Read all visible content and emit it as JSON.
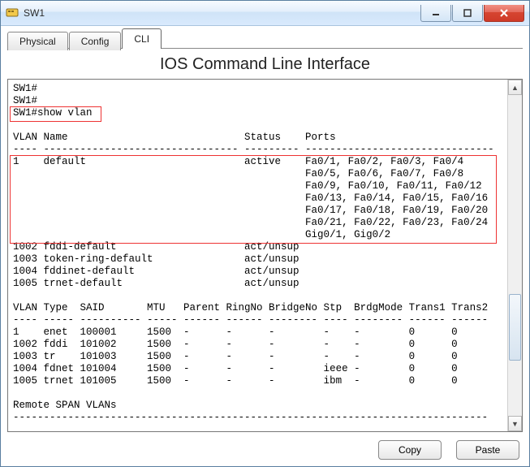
{
  "window": {
    "title": "SW1"
  },
  "tabs": {
    "physical": "Physical",
    "config": "Config",
    "cli": "CLI"
  },
  "panel_title": "IOS Command Line Interface",
  "buttons": {
    "copy": "Copy",
    "paste": "Paste"
  },
  "cli": {
    "prompt1": "SW1#",
    "prompt2": "SW1#",
    "cmdline": "SW1#show vlan",
    "blank": "",
    "hdr1": "VLAN Name                             Status    Ports",
    "hdr1rule": "---- -------------------------------- --------- -------------------------------",
    "r1": "1    default                          active    Fa0/1, Fa0/2, Fa0/3, Fa0/4",
    "r1b": "                                                Fa0/5, Fa0/6, Fa0/7, Fa0/8",
    "r1c": "                                                Fa0/9, Fa0/10, Fa0/11, Fa0/12",
    "r1d": "                                                Fa0/13, Fa0/14, Fa0/15, Fa0/16",
    "r1e": "                                                Fa0/17, Fa0/18, Fa0/19, Fa0/20",
    "r1f": "                                                Fa0/21, Fa0/22, Fa0/23, Fa0/24",
    "r1g": "                                                Gig0/1, Gig0/2",
    "r2": "1002 fddi-default                     act/unsup",
    "r3": "1003 token-ring-default               act/unsup",
    "r4": "1004 fddinet-default                  act/unsup",
    "r5": "1005 trnet-default                    act/unsup",
    "hdr2": "VLAN Type  SAID       MTU   Parent RingNo BridgeNo Stp  BrdgMode Trans1 Trans2",
    "hdr2rule": "---- ----- ---------- ----- ------ ------ -------- ---- -------- ------ ------",
    "t1": "1    enet  100001     1500  -      -      -        -    -        0      0",
    "t2": "1002 fddi  101002     1500  -      -      -        -    -        0      0",
    "t3": "1003 tr    101003     1500  -      -      -        -    -        0      0",
    "t4": "1004 fdnet 101004     1500  -      -      -        ieee -        0      0",
    "t5": "1005 trnet 101005     1500  -      -      -        ibm  -        0      0",
    "span": "Remote SPAN VLANs",
    "spanrule": "------------------------------------------------------------------------------"
  }
}
